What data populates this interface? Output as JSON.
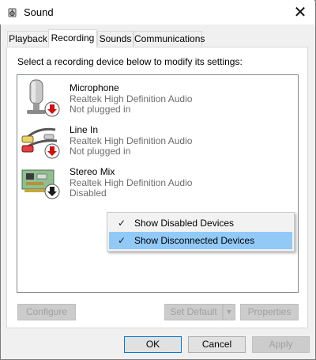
{
  "window": {
    "title": "Sound",
    "close_glyph": "✕"
  },
  "tabs": [
    {
      "label": "Playback"
    },
    {
      "label": "Recording"
    },
    {
      "label": "Sounds"
    },
    {
      "label": "Communications"
    }
  ],
  "instruction": "Select a recording device below to modify its settings:",
  "devices": [
    {
      "name": "Microphone",
      "driver": "Realtek High Definition Audio",
      "status": "Not plugged in",
      "icon": "microphone-icon",
      "badge": "red-down-arrow"
    },
    {
      "name": "Line In",
      "driver": "Realtek High Definition Audio",
      "status": "Not plugged in",
      "icon": "line-in-cable-icon",
      "badge": "red-down-arrow"
    },
    {
      "name": "Stereo Mix",
      "driver": "Realtek High Definition Audio",
      "status": "Disabled",
      "icon": "sound-card-icon",
      "badge": "black-down-arrow"
    }
  ],
  "context_menu": [
    {
      "label": "Show Disabled Devices",
      "checked": "✓"
    },
    {
      "label": "Show Disconnected Devices",
      "checked": "✓"
    }
  ],
  "buttons": {
    "configure": "Configure",
    "set_default": "Set Default",
    "set_default_arrow": "▼",
    "properties": "Properties",
    "ok": "OK",
    "cancel": "Cancel",
    "apply": "Apply"
  },
  "colors": {
    "highlight": "#91c9f7",
    "badge_red": "#d01010",
    "focus_border": "#0078d7"
  }
}
